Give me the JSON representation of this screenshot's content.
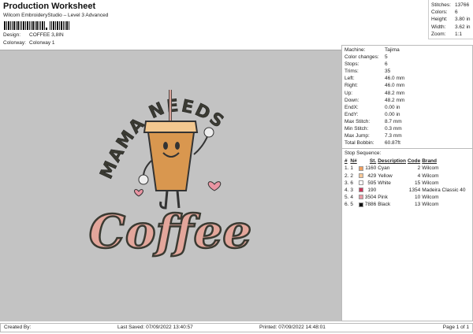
{
  "header": {
    "title": "Production Worksheet",
    "subtitle": "Wilcom EmbroideryStudio – Level 3 Advanced",
    "design_label": "Design:",
    "design_value": "COFFEE 3,8IN",
    "colorway_label": "Colorway:",
    "colorway_value": "Colorway 1"
  },
  "stats": [
    {
      "label": "Stitches:",
      "value": "13766"
    },
    {
      "label": "Colors:",
      "value": "6"
    },
    {
      "label": "Height:",
      "value": "3.80 in"
    },
    {
      "label": "Width:",
      "value": "3.62 in"
    },
    {
      "label": "Zoom:",
      "value": "1:1"
    }
  ],
  "info": [
    {
      "label": "Machine:",
      "value": "Tajima"
    },
    {
      "label": "Color changes:",
      "value": "5"
    },
    {
      "label": "Stops:",
      "value": "6"
    },
    {
      "label": "Trims:",
      "value": "35"
    },
    {
      "label": "Left:",
      "value": "46.0 mm"
    },
    {
      "label": "Right:",
      "value": "46.0 mm"
    },
    {
      "label": "Up:",
      "value": "48.2 mm"
    },
    {
      "label": "Down:",
      "value": "48.2 mm"
    },
    {
      "label": "EndX:",
      "value": "0.00 in"
    },
    {
      "label": "EndY:",
      "value": "0.00 in"
    },
    {
      "label": "Max Stitch:",
      "value": "8.7 mm"
    },
    {
      "label": "Min Stitch:",
      "value": "0.3 mm"
    },
    {
      "label": "Max Jump:",
      "value": "7.3 mm"
    },
    {
      "label": "Total Bobbin:",
      "value": "60.87ft"
    }
  ],
  "stop_sequence": {
    "title": "Stop Sequence:",
    "headers": [
      "#",
      "N#",
      "St.",
      "Description",
      "Code",
      "Brand"
    ],
    "rows": [
      {
        "n": "1.",
        "nn": "1",
        "color": "#f0a060",
        "st": "1160",
        "desc": "Cyan",
        "code": "2",
        "brand": "Wilcom"
      },
      {
        "n": "2.",
        "nn": "2",
        "color": "#f7c898",
        "st": "429",
        "desc": "Yellow",
        "code": "4",
        "brand": "Wilcom"
      },
      {
        "n": "3.",
        "nn": "6",
        "color": "#ffffff",
        "st": "595",
        "desc": "White",
        "code": "15",
        "brand": "Wilcom"
      },
      {
        "n": "4.",
        "nn": "3",
        "color": "#c8365a",
        "st": "190",
        "desc": "",
        "code": "1354",
        "brand": "Madeira Classic 40"
      },
      {
        "n": "5.",
        "nn": "4",
        "color": "#e89aa4",
        "st": "3504",
        "desc": "Pink",
        "code": "10",
        "brand": "Wilcom"
      },
      {
        "n": "6.",
        "nn": "5",
        "color": "#111111",
        "st": "7886",
        "desc": "Black",
        "code": "13",
        "brand": "Wilcom"
      }
    ]
  },
  "artwork": {
    "top_text": "MAMA NEEDS",
    "bottom_text": "Coffee"
  },
  "footer": {
    "created_by": "Created By:",
    "last_saved": "Last Saved: 07/09/2022 13:40:57",
    "printed": "Printed: 07/09/2022 14:48:01",
    "page": "Page 1 of 1"
  }
}
